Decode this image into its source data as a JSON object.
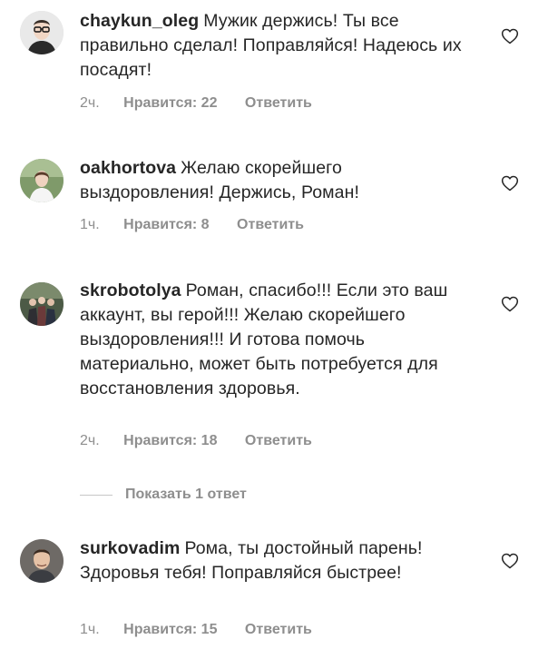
{
  "comments": [
    {
      "username": "chaykun_oleg",
      "text": "Мужик держись! Ты все правильно сделал! Поправляйся! Надеюсь их посадят!",
      "time": "2ч.",
      "likes": "Нравится: 22",
      "reply": "Ответить",
      "avatar_icon": "avatar-man-glasses"
    },
    {
      "username": "oakhortova",
      "text": "Желаю скорейшего выздоровления! Держись, Роман!",
      "time": "1ч.",
      "likes": "Нравится: 8",
      "reply": "Ответить",
      "avatar_icon": "avatar-woman-outdoors"
    },
    {
      "username": "skrobotolya",
      "text": "Роман, спасибо!!! Если это ваш аккаунт, вы герой!!! Желаю скорейшего выздоровления!!! И готова помочь материально, может быть потребуется для восстановления здоровья.",
      "time": "2ч.",
      "likes": "Нравится: 18",
      "reply": "Ответить",
      "avatar_icon": "avatar-people-group"
    },
    {
      "username": "surkovadim",
      "text": "Рома, ты достойный парень! Здоровья тебя! Поправляйся быстрее!",
      "time": "1ч.",
      "likes": "Нравится: 15",
      "reply": "Ответить",
      "avatar_icon": "avatar-man-portrait"
    }
  ],
  "view_replies_label": "Показать 1 ответ",
  "icons": {
    "like": "heart-outline-icon"
  },
  "colors": {
    "text": "#262626",
    "meta": "#8e8e8e",
    "divider": "#c7c7c7"
  }
}
